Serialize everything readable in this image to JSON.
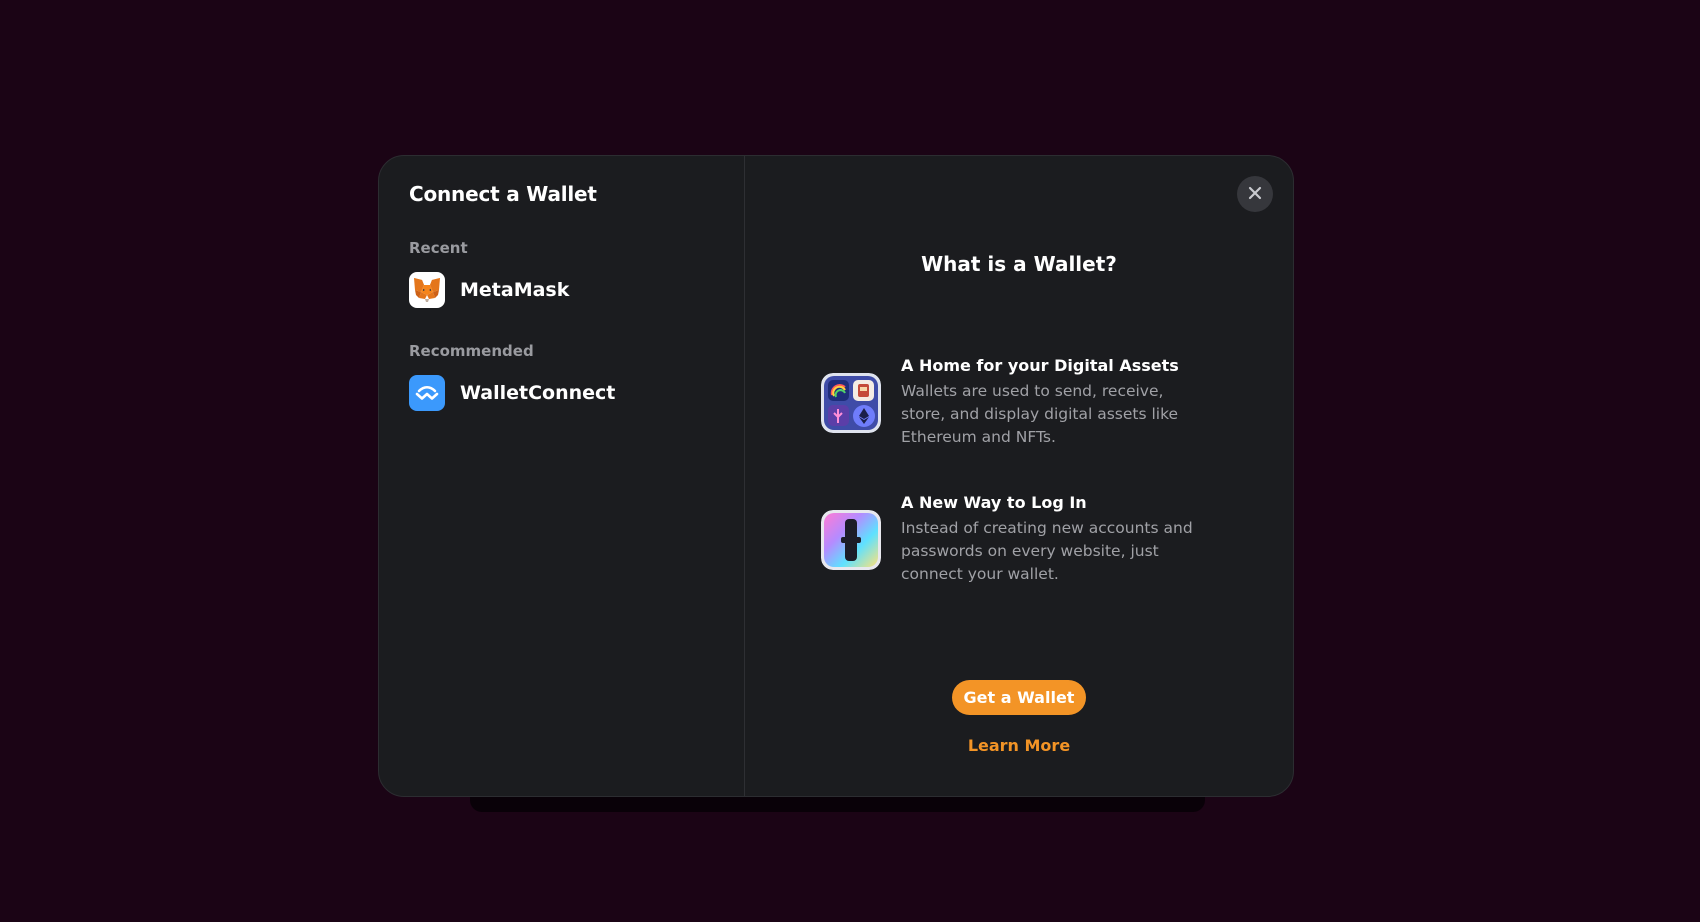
{
  "modal": {
    "title": "Connect a Wallet",
    "groups": [
      {
        "label": "Recent",
        "wallets": [
          {
            "name": "MetaMask",
            "icon": "metamask-fox-icon"
          }
        ]
      },
      {
        "label": "Recommended",
        "wallets": [
          {
            "name": "WalletConnect",
            "icon": "walletconnect-icon"
          }
        ]
      }
    ],
    "close_icon": "close-icon"
  },
  "info": {
    "title": "What is a Wallet?",
    "items": [
      {
        "heading": "A Home for your Digital Assets",
        "body": "Wallets are used to send, receive, store, and display digital assets like Ethereum and NFTs.",
        "icon": "digital-assets-icon"
      },
      {
        "heading": "A New Way to Log In",
        "body": "Instead of creating new accounts and passwords on every website, just connect your wallet.",
        "icon": "login-keyhole-icon"
      }
    ],
    "get_wallet_label": "Get a Wallet",
    "learn_more_label": "Learn More"
  },
  "colors": {
    "background": "#1b0415",
    "modal": "#1b1c1f",
    "accent": "#f39426",
    "walletconnect": "#3b99fc"
  }
}
